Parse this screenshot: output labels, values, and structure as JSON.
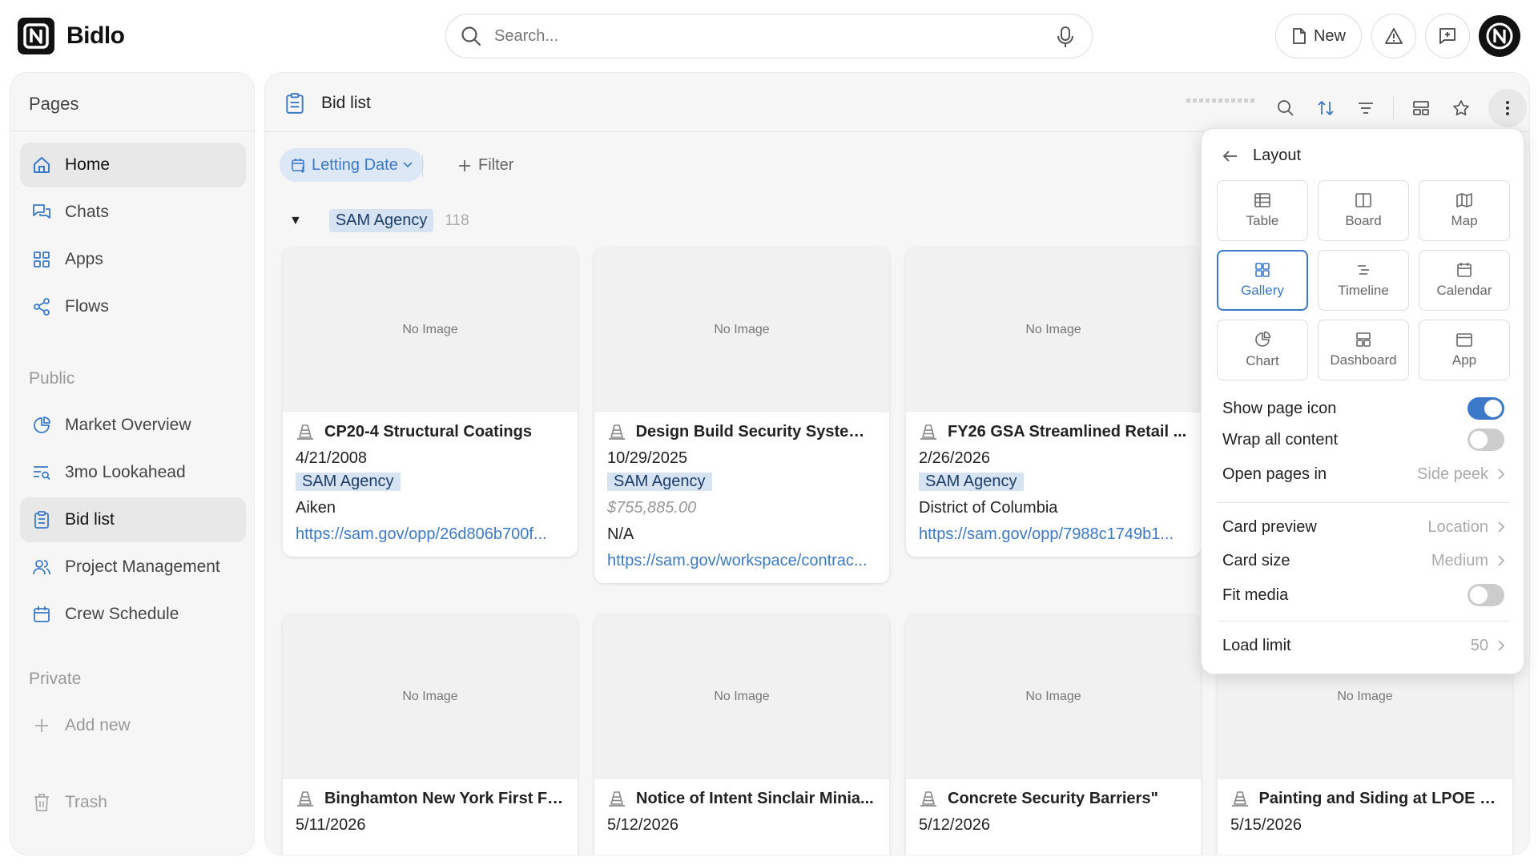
{
  "app": {
    "brand": "Bidlo",
    "search_placeholder": "Search...",
    "new_label": "New"
  },
  "sidebar": {
    "title": "Pages",
    "items": [
      {
        "label": "Home"
      },
      {
        "label": "Chats"
      },
      {
        "label": "Apps"
      },
      {
        "label": "Flows"
      }
    ],
    "public_label": "Public",
    "public_items": [
      {
        "label": "Market Overview"
      },
      {
        "label": "3mo Lookahead"
      },
      {
        "label": "Bid list"
      },
      {
        "label": "Project Management"
      },
      {
        "label": "Crew Schedule"
      }
    ],
    "private_label": "Private",
    "add_new_label": "Add new",
    "trash_label": "Trash"
  },
  "main": {
    "title": "Bid list",
    "sort_chip": "Letting Date",
    "filter_label": "Filter",
    "group": {
      "name": "SAM Agency",
      "count": "118"
    }
  },
  "cards": [
    {
      "image": "No Image",
      "title": "CP20-4 Structural Coatings",
      "date": "4/21/2008",
      "agency": "SAM Agency",
      "line3": "Aiken",
      "link": "https://sam.gov/opp/26d806b700f..."
    },
    {
      "image": "No Image",
      "title": "Design Build Security System ...",
      "date": "10/29/2025",
      "agency": "SAM Agency",
      "price": "$755,885.00",
      "line3": "N/A",
      "link": "https://sam.gov/workspace/contrac..."
    },
    {
      "image": "No Image",
      "title": "FY26 GSA Streamlined Retail ...",
      "date": "2/26/2026",
      "agency": "SAM Agency",
      "line3": "District of Columbia",
      "link": "https://sam.gov/opp/7988c1749b1..."
    },
    {
      "image": "No Image",
      "title": "Binghamton New York First Fl...",
      "date": "5/11/2026"
    },
    {
      "image": "No Image",
      "title": "Notice of Intent Sinclair Minia...",
      "date": "5/12/2026"
    },
    {
      "image": "No Image",
      "title": "Concrete Security Barriers\"",
      "date": "5/12/2026"
    },
    {
      "image": "No Image",
      "title": "Painting and Siding at LPOE B...",
      "date": "5/15/2026"
    }
  ],
  "layout_panel": {
    "title": "Layout",
    "options": [
      {
        "label": "Table"
      },
      {
        "label": "Board"
      },
      {
        "label": "Map"
      },
      {
        "label": "Gallery"
      },
      {
        "label": "Timeline"
      },
      {
        "label": "Calendar"
      },
      {
        "label": "Chart"
      },
      {
        "label": "Dashboard"
      },
      {
        "label": "App"
      }
    ],
    "selected": "Gallery",
    "show_page_icon": {
      "label": "Show page icon",
      "on": true
    },
    "wrap_all_content": {
      "label": "Wrap all content",
      "on": false
    },
    "open_pages_in": {
      "label": "Open pages in",
      "value": "Side peek"
    },
    "card_preview": {
      "label": "Card preview",
      "value": "Location"
    },
    "card_size": {
      "label": "Card size",
      "value": "Medium"
    },
    "fit_media": {
      "label": "Fit media",
      "on": false
    },
    "load_limit": {
      "label": "Load limit",
      "value": "50"
    }
  },
  "colors": {
    "accent": "#3b79c8",
    "tag_bg": "#d5e3f3"
  }
}
